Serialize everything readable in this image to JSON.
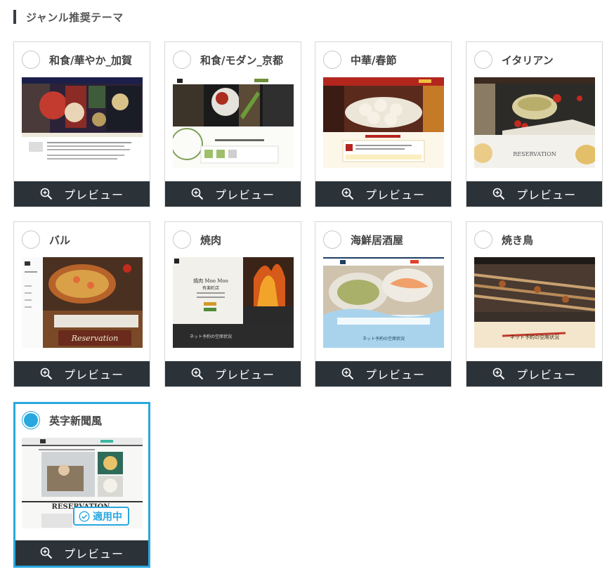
{
  "section": {
    "title": "ジャンル推奨テーマ"
  },
  "preview_label": "プレビュー",
  "applied_label": "適用中",
  "accent_color": "#29a8e0",
  "themes": [
    {
      "name": "和食/華やか_加賀",
      "selected": false
    },
    {
      "name": "和食/モダン_京都",
      "selected": false
    },
    {
      "name": "中華/春節",
      "selected": false
    },
    {
      "name": "イタリアン",
      "selected": false
    },
    {
      "name": "バル",
      "selected": false
    },
    {
      "name": "焼肉",
      "selected": false
    },
    {
      "name": "海鮮居酒屋",
      "selected": false
    },
    {
      "name": "焼き鳥",
      "selected": false
    },
    {
      "name": "英字新聞風",
      "selected": true
    }
  ],
  "thumb_text": {
    "yakiniku_title": "焼肉 Moo Moo",
    "yakiniku_sub": "有楽町店",
    "reservation": "RESERVATION",
    "reservation_script": "Reservation",
    "net_reserve": "ネット予約の空席状況"
  }
}
